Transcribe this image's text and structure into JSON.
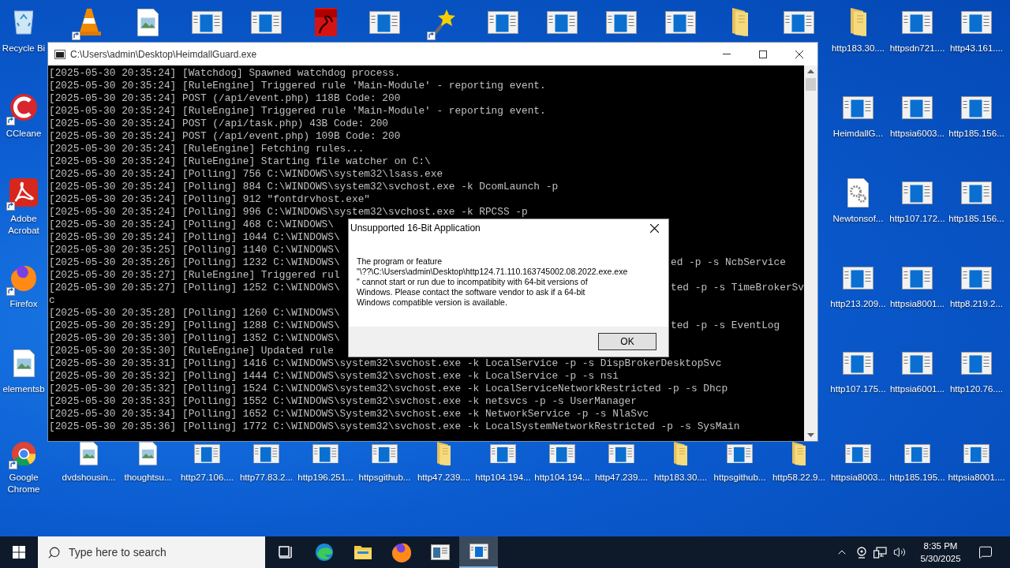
{
  "desktop": {
    "icon_rows": [
      [
        {
          "kind": "recycle",
          "label": "Recycle Bi",
          "shortcut": false
        },
        {
          "kind": "cone",
          "shortcut": true
        },
        {
          "kind": "image",
          "shortcut": false
        },
        {
          "kind": "window",
          "shortcut": false
        },
        {
          "kind": "window",
          "shortcut": false
        },
        {
          "kind": "pdf",
          "shortcut": false
        },
        {
          "kind": "window",
          "shortcut": false
        },
        {
          "kind": "wand",
          "shortcut": true
        },
        {
          "kind": "window",
          "shortcut": false
        },
        {
          "kind": "window",
          "shortcut": false
        },
        {
          "kind": "window",
          "shortcut": false
        },
        {
          "kind": "window",
          "shortcut": false
        },
        {
          "kind": "folder",
          "shortcut": false
        },
        {
          "kind": "window",
          "shortcut": false
        },
        {
          "kind": "folder",
          "label": "http183.30....",
          "shortcut": false
        },
        {
          "kind": "window",
          "label": "httpsdn721....",
          "shortcut": false
        },
        {
          "kind": "window",
          "label": "http43.161....",
          "shortcut": false
        }
      ],
      [
        {
          "kind": "ring",
          "label": "CCleane",
          "shortcut": true
        },
        {
          "kind": "empty"
        },
        {
          "kind": "empty"
        },
        {
          "kind": "empty"
        },
        {
          "kind": "empty"
        },
        {
          "kind": "empty"
        },
        {
          "kind": "empty"
        },
        {
          "kind": "empty"
        },
        {
          "kind": "empty"
        },
        {
          "kind": "empty"
        },
        {
          "kind": "empty"
        },
        {
          "kind": "empty"
        },
        {
          "kind": "empty"
        },
        {
          "kind": "empty"
        },
        {
          "kind": "window",
          "label": "HeimdallG...",
          "shortcut": false
        },
        {
          "kind": "window",
          "label": "httpsia6003...",
          "shortcut": false
        },
        {
          "kind": "window",
          "label": "http185.156...",
          "shortcut": false
        }
      ],
      [
        {
          "kind": "acrobat",
          "label": "Adobe Acrobat",
          "shortcut": true
        },
        {
          "kind": "empty"
        },
        {
          "kind": "empty"
        },
        {
          "kind": "empty"
        },
        {
          "kind": "empty"
        },
        {
          "kind": "empty"
        },
        {
          "kind": "empty"
        },
        {
          "kind": "empty"
        },
        {
          "kind": "empty"
        },
        {
          "kind": "empty"
        },
        {
          "kind": "empty"
        },
        {
          "kind": "empty"
        },
        {
          "kind": "empty"
        },
        {
          "kind": "empty"
        },
        {
          "kind": "gear",
          "label": "Newtonsof...",
          "shortcut": false
        },
        {
          "kind": "window",
          "label": "http107.172...",
          "shortcut": false
        },
        {
          "kind": "window",
          "label": "http185.156...",
          "shortcut": false
        }
      ],
      [
        {
          "kind": "firefox",
          "label": "Firefox",
          "shortcut": true
        },
        {
          "kind": "empty"
        },
        {
          "kind": "empty"
        },
        {
          "kind": "empty"
        },
        {
          "kind": "empty"
        },
        {
          "kind": "empty"
        },
        {
          "kind": "empty"
        },
        {
          "kind": "empty"
        },
        {
          "kind": "empty"
        },
        {
          "kind": "empty"
        },
        {
          "kind": "empty"
        },
        {
          "kind": "empty"
        },
        {
          "kind": "empty"
        },
        {
          "kind": "empty"
        },
        {
          "kind": "window",
          "label": "http213.209...",
          "shortcut": false
        },
        {
          "kind": "window",
          "label": "httpsia8001...",
          "shortcut": false
        },
        {
          "kind": "window",
          "label": "http8.219.2...",
          "shortcut": false
        }
      ],
      [
        {
          "kind": "image",
          "label": "elementsb",
          "shortcut": false
        },
        {
          "kind": "empty"
        },
        {
          "kind": "empty"
        },
        {
          "kind": "empty"
        },
        {
          "kind": "empty"
        },
        {
          "kind": "empty"
        },
        {
          "kind": "empty"
        },
        {
          "kind": "empty"
        },
        {
          "kind": "empty"
        },
        {
          "kind": "empty"
        },
        {
          "kind": "empty"
        },
        {
          "kind": "empty"
        },
        {
          "kind": "empty"
        },
        {
          "kind": "empty"
        },
        {
          "kind": "window",
          "label": "http107.175...",
          "shortcut": false
        },
        {
          "kind": "window",
          "label": "httpsia6001...",
          "shortcut": false
        },
        {
          "kind": "window",
          "label": "http120.76....",
          "shortcut": false
        }
      ],
      [
        {
          "kind": "chrome",
          "label": "Google Chrome",
          "shortcut": true
        },
        {
          "kind": "image",
          "label": "dvdshousin...",
          "shortcut": false
        },
        {
          "kind": "image",
          "label": "thoughtsu...",
          "shortcut": false
        },
        {
          "kind": "window",
          "label": "http27.106....",
          "shortcut": false
        },
        {
          "kind": "window",
          "label": "http77.83.2...",
          "shortcut": false
        },
        {
          "kind": "window",
          "label": "http196.251...",
          "shortcut": false
        },
        {
          "kind": "window",
          "label": "httpsgithub...",
          "shortcut": false
        },
        {
          "kind": "folder",
          "label": "http47.239....",
          "shortcut": false
        },
        {
          "kind": "window",
          "label": "http104.194...",
          "shortcut": false
        },
        {
          "kind": "window",
          "label": "http104.194...",
          "shortcut": false
        },
        {
          "kind": "window",
          "label": "http47.239....",
          "shortcut": false
        },
        {
          "kind": "folder",
          "label": "http183.30....",
          "shortcut": false
        },
        {
          "kind": "window",
          "label": "httpsgithub...",
          "shortcut": false
        },
        {
          "kind": "folder",
          "label": "http58.22.9...",
          "shortcut": false
        },
        {
          "kind": "window",
          "label": "httpsia8003...",
          "shortcut": false
        },
        {
          "kind": "window",
          "label": "http185.195...",
          "shortcut": false
        },
        {
          "kind": "window",
          "label": "httpsia8001....",
          "shortcut": false
        }
      ]
    ]
  },
  "console_window": {
    "title": "C:\\Users\\admin\\Desktop\\HeimdallGuard.exe",
    "lines": [
      {
        "text": "[2025-05-30 20:35:24] [Watchdog] Spawned watchdog process."
      },
      {
        "text": "[2025-05-30 20:35:24] [RuleEngine] Triggered rule 'Main-Module' - reporting event."
      },
      {
        "text": "[2025-05-30 20:35:24] POST (/api/event.php) 118B Code: 200"
      },
      {
        "text": "[2025-05-30 20:35:24] [RuleEngine] Triggered rule 'Main-Module' - reporting event."
      },
      {
        "text": "[2025-05-30 20:35:24] POST (/api/task.php) 43B Code: 200"
      },
      {
        "text": "[2025-05-30 20:35:24] POST (/api/event.php) 109B Code: 200"
      },
      {
        "text": "[2025-05-30 20:35:24] [RuleEngine] Fetching rules..."
      },
      {
        "text": "[2025-05-30 20:35:24] [RuleEngine] Starting file watcher on C:\\"
      },
      {
        "text": "[2025-05-30 20:35:24] [Polling] 756 C:\\WINDOWS\\system32\\lsass.exe"
      },
      {
        "text": "[2025-05-30 20:35:24] [Polling] 884 C:\\WINDOWS\\system32\\svchost.exe -k DcomLaunch -p"
      },
      {
        "text": "[2025-05-30 20:35:24] [Polling] 912 \"fontdrvhost.exe\""
      },
      {
        "text": "[2025-05-30 20:35:24] [Polling] 996 C:\\WINDOWS\\system32\\svchost.exe -k RPCSS -p"
      },
      {
        "text": "[2025-05-30 20:35:24] [Polling] 468 C:\\WINDOWS\\"
      },
      {
        "text": "[2025-05-30 20:35:24] [Polling] 1044 C:\\WINDOWS\\"
      },
      {
        "text": "[2025-05-30 20:35:25] [Polling] 1140 C:\\WINDOWS\\"
      },
      {
        "text": "[2025-05-30 20:35:26] [Polling] 1232 C:\\WINDOWS\\",
        "right": "ed -p -s NcbService"
      },
      {
        "text": "[2025-05-30 20:35:27] [RuleEngine] Triggered rul"
      },
      {
        "text": "[2025-05-30 20:35:27] [Polling] 1252 C:\\WINDOWS\\",
        "right": "ted -p -s TimeBrokerSv"
      },
      {
        "text": "c"
      },
      {
        "text": "[2025-05-30 20:35:28] [Polling] 1260 C:\\WINDOWS\\"
      },
      {
        "text": "[2025-05-30 20:35:29] [Polling] 1288 C:\\WINDOWS\\",
        "right": "ted -p -s EventLog"
      },
      {
        "text": "[2025-05-30 20:35:30] [Polling] 1352 C:\\WINDOWS\\"
      },
      {
        "text": "[2025-05-30 20:35:30] [RuleEngine] Updated rule"
      },
      {
        "text": "[2025-05-30 20:35:31] [Polling] 1416 C:\\WINDOWS\\system32\\svchost.exe -k LocalService -p -s DispBrokerDesktopSvc"
      },
      {
        "text": "[2025-05-30 20:35:32] [Polling] 1444 C:\\WINDOWS\\system32\\svchost.exe -k LocalService -p -s nsi"
      },
      {
        "text": "[2025-05-30 20:35:32] [Polling] 1524 C:\\WINDOWS\\system32\\svchost.exe -k LocalServiceNetworkRestricted -p -s Dhcp"
      },
      {
        "text": "[2025-05-30 20:35:33] [Polling] 1552 C:\\WINDOWS\\system32\\svchost.exe -k netsvcs -p -s UserManager"
      },
      {
        "text": "[2025-05-30 20:35:34] [Polling] 1652 C:\\WINDOWS\\System32\\svchost.exe -k NetworkService -p -s NlaSvc"
      },
      {
        "text": "[2025-05-30 20:35:36] [Polling] 1772 C:\\WINDOWS\\system32\\svchost.exe -k LocalSystemNetworkRestricted -p -s SysMain"
      }
    ]
  },
  "dialog": {
    "title": "Unsupported 16-Bit Application",
    "message_lines": [
      "The program or feature",
      "\"\\??\\C:\\Users\\admin\\Desktop\\http124.71.110.163745002.08.2022.exe.exe",
      "\" cannot start or run due to incompatibity with 64-bit versions of",
      "Windows. Please contact the software vendor to ask if a 64-bit",
      "Windows compatible version is available."
    ],
    "button": "OK"
  },
  "taskbar": {
    "search": {
      "placeholder": "Type here to search"
    },
    "apps": [
      {
        "kind": "taskview",
        "selected": false
      },
      {
        "kind": "edge",
        "selected": false
      },
      {
        "kind": "explorer",
        "selected": false
      },
      {
        "kind": "firefox",
        "selected": false
      },
      {
        "kind": "app",
        "selected": false
      },
      {
        "kind": "window",
        "selected": true
      }
    ],
    "time": "8:35 PM",
    "date": "5/30/2025"
  }
}
